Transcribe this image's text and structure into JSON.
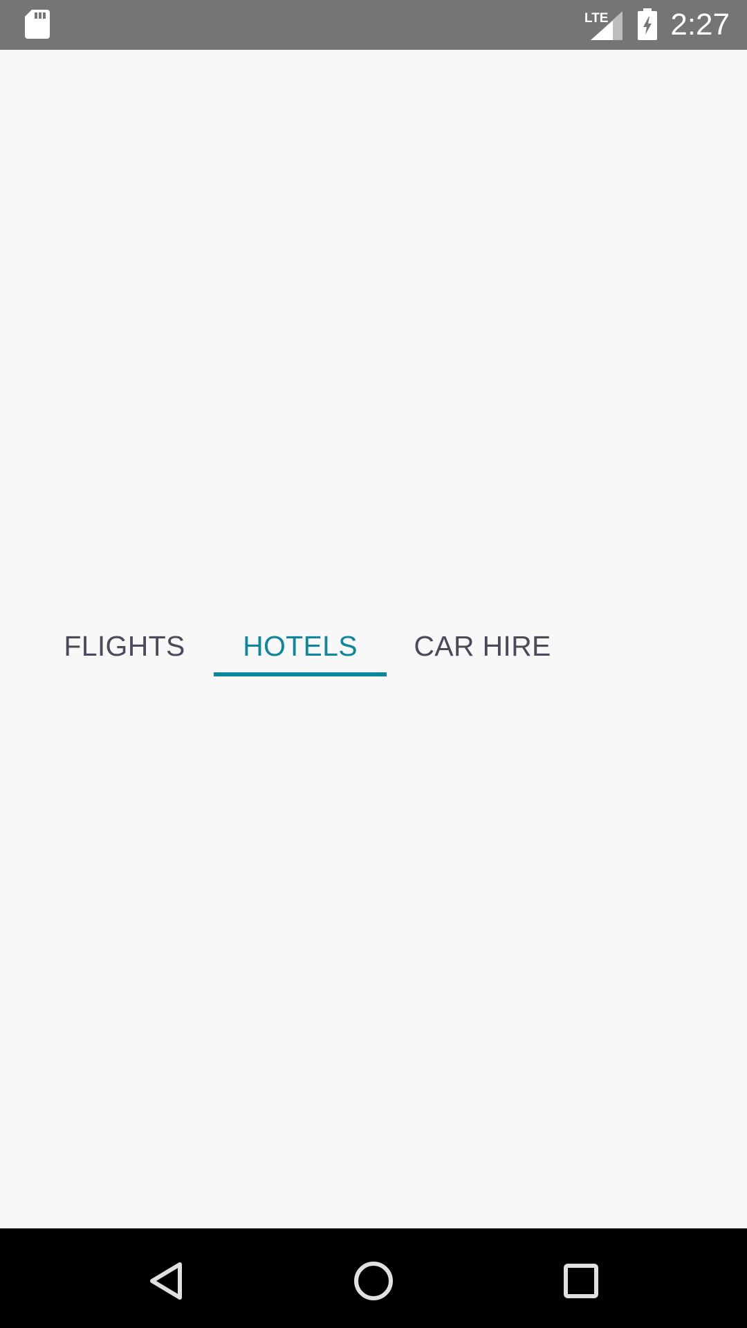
{
  "status_bar": {
    "time": "2:27",
    "network": "LTE",
    "icons": [
      "sd-card-icon",
      "lte-signal-icon",
      "battery-charging-icon"
    ]
  },
  "tabs": [
    {
      "label": "FLIGHTS",
      "active": false
    },
    {
      "label": "HOTELS",
      "active": true
    },
    {
      "label": "CAR HIRE",
      "active": false
    }
  ],
  "nav_bar": {
    "icons": [
      "back-icon",
      "home-icon",
      "recents-icon"
    ]
  },
  "colors": {
    "accent": "#0e879c",
    "tab_text": "#4a4a5a",
    "background": "#f8f8f9",
    "status_bar": "#757575",
    "nav_bar": "#000000"
  }
}
